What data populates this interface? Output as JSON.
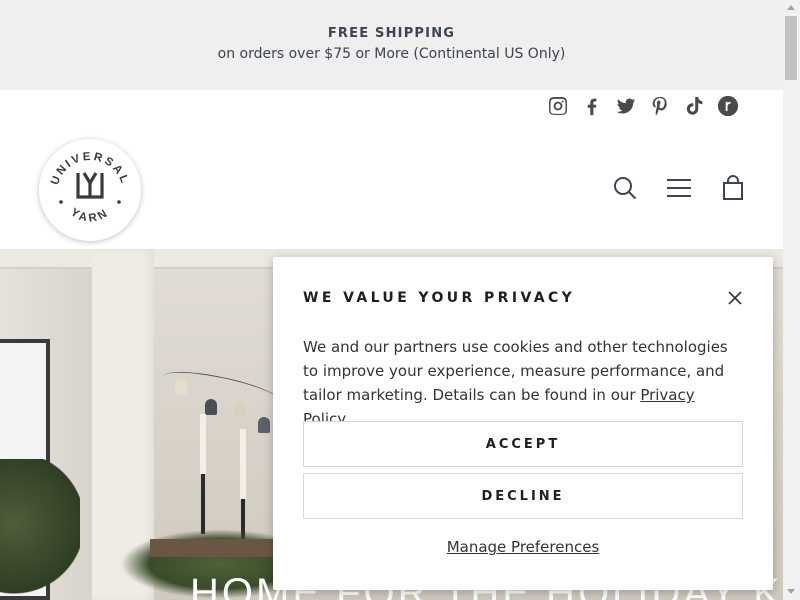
{
  "announcement": {
    "title": "FREE SHIPPING",
    "subtitle": "on orders over $75 or More (Continental US Only)"
  },
  "social": [
    "instagram-icon",
    "facebook-icon",
    "twitter-icon",
    "pinterest-icon",
    "tiktok-icon",
    "ravelry-icon"
  ],
  "logo": {
    "text_top": "UNIVERSAL",
    "text_bottom": "YARN",
    "monogram": "UY"
  },
  "header_icons": [
    "search-icon",
    "menu-icon",
    "cart-icon"
  ],
  "hero": {
    "title": "HOME FOR THE HOLIDAY KITS"
  },
  "privacy": {
    "title": "WE VALUE YOUR PRIVACY",
    "body": "We and our partners use cookies and other technologies to improve your experience, measure performance, and tailor marketing. Details can be found in our ",
    "link": "Privacy Policy.",
    "accept": "ACCEPT",
    "decline": "DECLINE",
    "manage": "Manage Preferences"
  },
  "colors": {
    "announce_bg": "#efefef",
    "text_dark": "#3b4452",
    "icon": "#4a4a4a"
  }
}
